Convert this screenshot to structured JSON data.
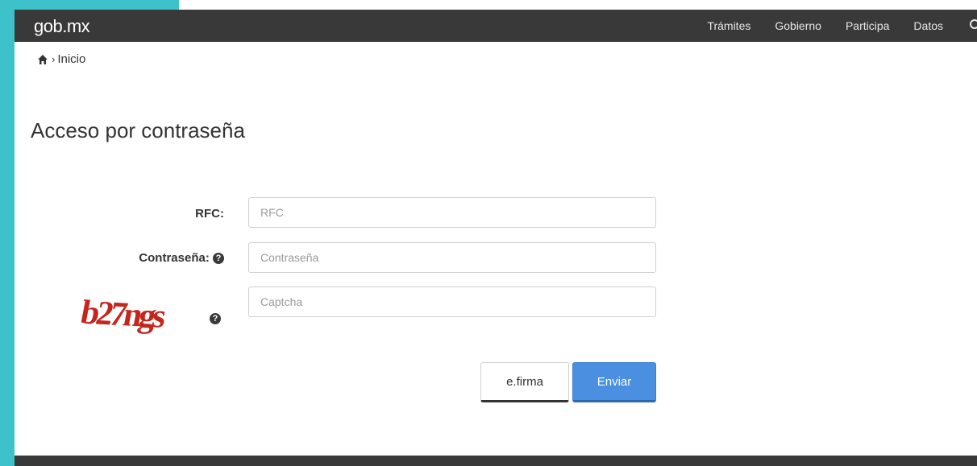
{
  "header": {
    "brand": "gob.mx",
    "nav": [
      "Trámites",
      "Gobierno",
      "Participa",
      "Datos"
    ],
    "search_icon": "search-icon"
  },
  "breadcrumb": {
    "home_icon": "home-icon",
    "separator": "›",
    "current": "Inicio"
  },
  "page": {
    "title": "Acceso por contraseña"
  },
  "form": {
    "rfc_label": "RFC:",
    "rfc_placeholder": "RFC",
    "password_label": "Contraseña:",
    "password_placeholder": "Contraseña",
    "captcha_text": "b27ngs",
    "captcha_placeholder": "Captcha",
    "help_icon": "question-circle-icon"
  },
  "buttons": {
    "efirma": "e.firma",
    "enviar": "Enviar"
  },
  "colors": {
    "header_bg": "#393939",
    "frame_teal": "#3cc2c8",
    "primary_button": "#4a8fe0",
    "captcha_red": "#c4251c"
  }
}
